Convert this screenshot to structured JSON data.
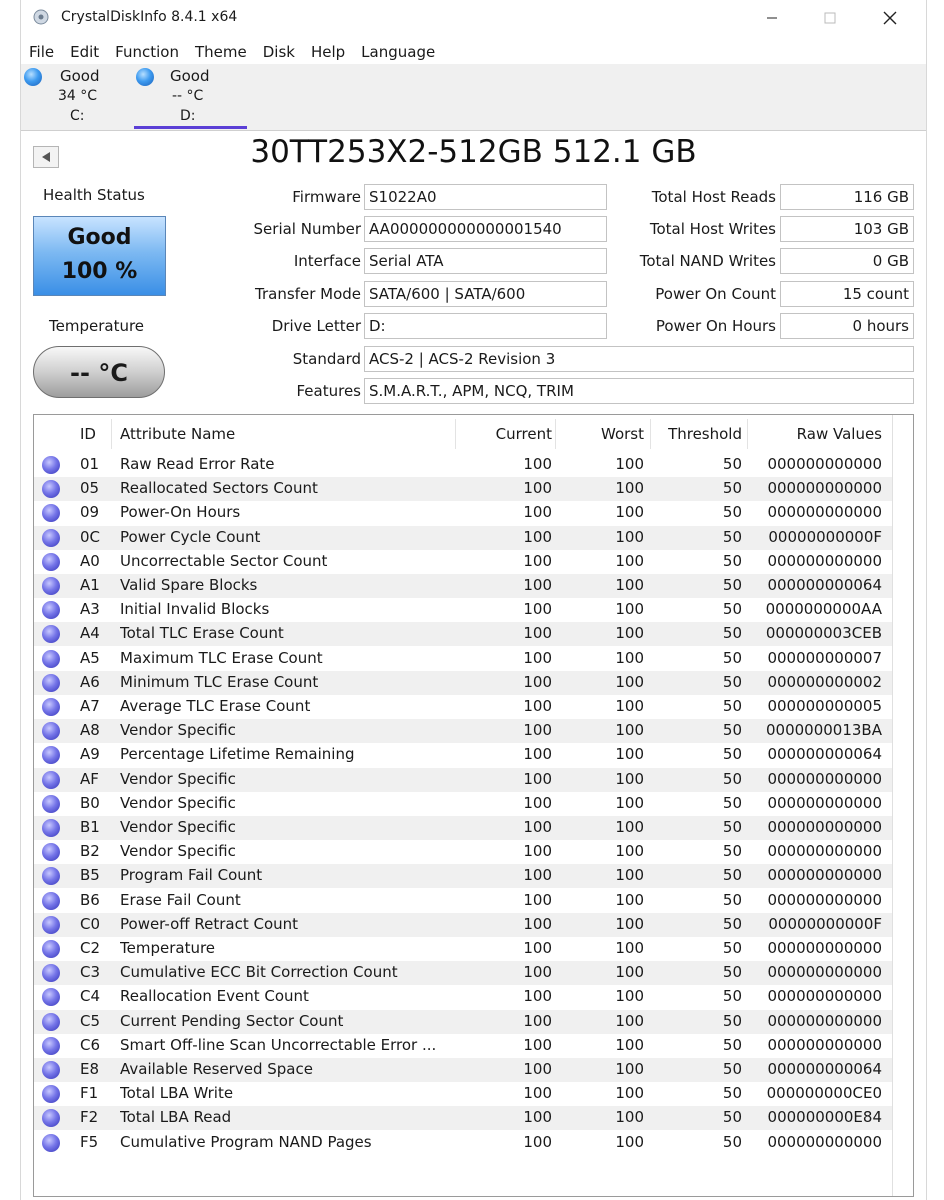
{
  "window": {
    "title": "CrystalDiskInfo 8.4.1 x64"
  },
  "menu": [
    "File",
    "Edit",
    "Function",
    "Theme",
    "Disk",
    "Help",
    "Language"
  ],
  "disks": [
    {
      "status": "Good",
      "temp": "34 °C",
      "letter": "C:"
    },
    {
      "status": "Good",
      "temp": "-- °C",
      "letter": "D:"
    }
  ],
  "drive": {
    "title": "30TT253X2-512GB 512.1 GB"
  },
  "health": {
    "label": "Health Status",
    "status": "Good",
    "percent": "100 %"
  },
  "temperature": {
    "label": "Temperature",
    "value": "-- °C"
  },
  "info": {
    "firmware_label": "Firmware",
    "firmware": "S1022A0",
    "serial_label": "Serial Number",
    "serial": "AA000000000000001540",
    "interface_label": "Interface",
    "interface": "Serial ATA",
    "transfer_label": "Transfer Mode",
    "transfer": "SATA/600 | SATA/600",
    "letter_label": "Drive Letter",
    "letter": "D:",
    "standard_label": "Standard",
    "standard": "ACS-2 | ACS-2 Revision 3",
    "features_label": "Features",
    "features": "S.M.A.R.T., APM, NCQ, TRIM",
    "reads_label": "Total Host Reads",
    "reads": "116 GB",
    "writes_label": "Total Host Writes",
    "writes": "103 GB",
    "nand_label": "Total NAND Writes",
    "nand": "0 GB",
    "count_label": "Power On Count",
    "count": "15 count",
    "hours_label": "Power On Hours",
    "hours": "0 hours"
  },
  "table": {
    "headers": {
      "id": "ID",
      "name": "Attribute Name",
      "current": "Current",
      "worst": "Worst",
      "threshold": "Threshold",
      "raw": "Raw Values"
    },
    "rows": [
      {
        "id": "01",
        "name": "Raw Read Error Rate",
        "current": "100",
        "worst": "100",
        "threshold": "50",
        "raw": "000000000000"
      },
      {
        "id": "05",
        "name": "Reallocated Sectors Count",
        "current": "100",
        "worst": "100",
        "threshold": "50",
        "raw": "000000000000"
      },
      {
        "id": "09",
        "name": "Power-On Hours",
        "current": "100",
        "worst": "100",
        "threshold": "50",
        "raw": "000000000000"
      },
      {
        "id": "0C",
        "name": "Power Cycle Count",
        "current": "100",
        "worst": "100",
        "threshold": "50",
        "raw": "00000000000F"
      },
      {
        "id": "A0",
        "name": "Uncorrectable Sector Count",
        "current": "100",
        "worst": "100",
        "threshold": "50",
        "raw": "000000000000"
      },
      {
        "id": "A1",
        "name": "Valid Spare Blocks",
        "current": "100",
        "worst": "100",
        "threshold": "50",
        "raw": "000000000064"
      },
      {
        "id": "A3",
        "name": "Initial Invalid Blocks",
        "current": "100",
        "worst": "100",
        "threshold": "50",
        "raw": "0000000000AA"
      },
      {
        "id": "A4",
        "name": "Total TLC Erase Count",
        "current": "100",
        "worst": "100",
        "threshold": "50",
        "raw": "000000003CEB"
      },
      {
        "id": "A5",
        "name": "Maximum TLC Erase Count",
        "current": "100",
        "worst": "100",
        "threshold": "50",
        "raw": "000000000007"
      },
      {
        "id": "A6",
        "name": "Minimum TLC Erase Count",
        "current": "100",
        "worst": "100",
        "threshold": "50",
        "raw": "000000000002"
      },
      {
        "id": "A7",
        "name": "Average TLC Erase Count",
        "current": "100",
        "worst": "100",
        "threshold": "50",
        "raw": "000000000005"
      },
      {
        "id": "A8",
        "name": "Vendor Specific",
        "current": "100",
        "worst": "100",
        "threshold": "50",
        "raw": "0000000013BA"
      },
      {
        "id": "A9",
        "name": "Percentage Lifetime Remaining",
        "current": "100",
        "worst": "100",
        "threshold": "50",
        "raw": "000000000064"
      },
      {
        "id": "AF",
        "name": "Vendor Specific",
        "current": "100",
        "worst": "100",
        "threshold": "50",
        "raw": "000000000000"
      },
      {
        "id": "B0",
        "name": "Vendor Specific",
        "current": "100",
        "worst": "100",
        "threshold": "50",
        "raw": "000000000000"
      },
      {
        "id": "B1",
        "name": "Vendor Specific",
        "current": "100",
        "worst": "100",
        "threshold": "50",
        "raw": "000000000000"
      },
      {
        "id": "B2",
        "name": "Vendor Specific",
        "current": "100",
        "worst": "100",
        "threshold": "50",
        "raw": "000000000000"
      },
      {
        "id": "B5",
        "name": "Program Fail Count",
        "current": "100",
        "worst": "100",
        "threshold": "50",
        "raw": "000000000000"
      },
      {
        "id": "B6",
        "name": "Erase Fail Count",
        "current": "100",
        "worst": "100",
        "threshold": "50",
        "raw": "000000000000"
      },
      {
        "id": "C0",
        "name": "Power-off Retract Count",
        "current": "100",
        "worst": "100",
        "threshold": "50",
        "raw": "00000000000F"
      },
      {
        "id": "C2",
        "name": "Temperature",
        "current": "100",
        "worst": "100",
        "threshold": "50",
        "raw": "000000000000"
      },
      {
        "id": "C3",
        "name": "Cumulative ECC Bit Correction Count",
        "current": "100",
        "worst": "100",
        "threshold": "50",
        "raw": "000000000000"
      },
      {
        "id": "C4",
        "name": "Reallocation Event Count",
        "current": "100",
        "worst": "100",
        "threshold": "50",
        "raw": "000000000000"
      },
      {
        "id": "C5",
        "name": "Current Pending Sector Count",
        "current": "100",
        "worst": "100",
        "threshold": "50",
        "raw": "000000000000"
      },
      {
        "id": "C6",
        "name": "Smart Off-line Scan Uncorrectable Error ...",
        "current": "100",
        "worst": "100",
        "threshold": "50",
        "raw": "000000000000"
      },
      {
        "id": "E8",
        "name": "Available Reserved Space",
        "current": "100",
        "worst": "100",
        "threshold": "50",
        "raw": "000000000064"
      },
      {
        "id": "F1",
        "name": "Total LBA Write",
        "current": "100",
        "worst": "100",
        "threshold": "50",
        "raw": "000000000CE0"
      },
      {
        "id": "F2",
        "name": "Total LBA Read",
        "current": "100",
        "worst": "100",
        "threshold": "50",
        "raw": "000000000E84"
      },
      {
        "id": "F5",
        "name": "Cumulative Program NAND Pages",
        "current": "100",
        "worst": "100",
        "threshold": "50",
        "raw": "000000000000"
      }
    ]
  },
  "colors": {
    "good_blue": "#3e9bf0",
    "attr_dot": "#7575e8",
    "tab_underline": "#5b3fd6"
  }
}
